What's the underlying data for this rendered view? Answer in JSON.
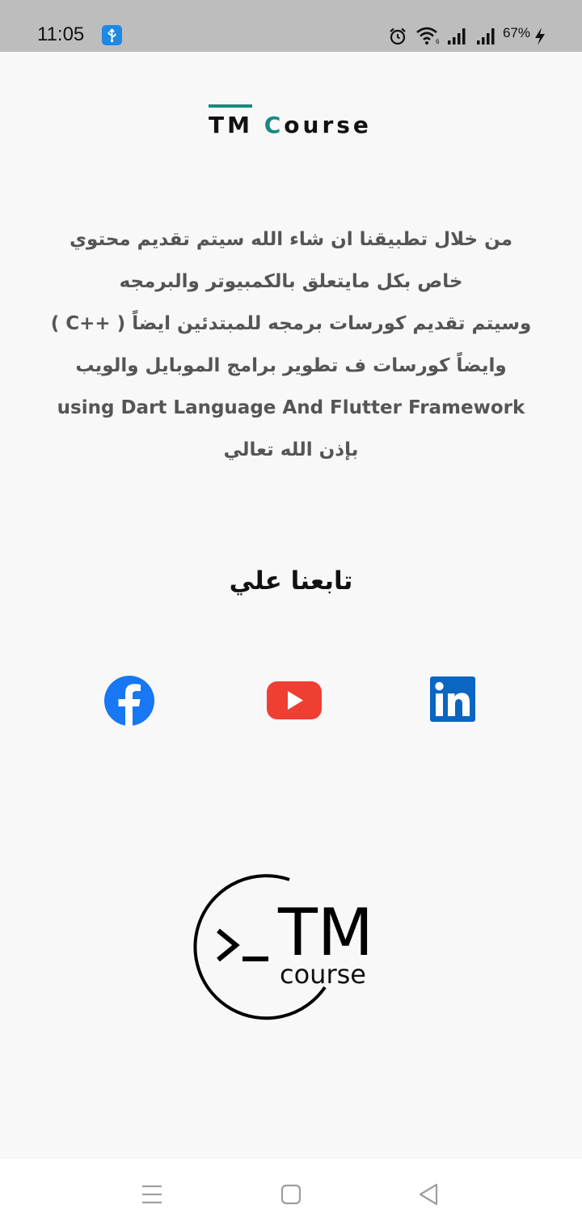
{
  "status_bar": {
    "time": "11:05",
    "battery": "67%",
    "icons": [
      "usb-icon",
      "alarm-icon",
      "wifi-icon",
      "signal-icon",
      "signal-icon",
      "charging-icon"
    ]
  },
  "brand": {
    "prefix": "TM ",
    "c_letter": "C",
    "rest": "ourse",
    "accent": "#1a8a7f"
  },
  "description": {
    "lines": [
      "من خلال تطبيقنا ان شاء الله سيتم تقديم محتوي",
      "خاص بكل مايتعلق بالكمبيوتر والبرمجه",
      "وسيتم تقديم كورسات برمجه للمبتدئين ايضاً ( ++C )",
      "وايضاً كورسات  ف تطوير برامج الموبايل والويب",
      "using Dart Language And Flutter Framework",
      "بإذن الله تعالي"
    ]
  },
  "follow": {
    "title": "تابعنا علي"
  },
  "social": {
    "items": [
      {
        "icon": "facebook-icon",
        "color": "#1877f2"
      },
      {
        "icon": "youtube-icon",
        "color": "#ef3f33"
      },
      {
        "icon": "linkedin-icon",
        "color": "#0a66c2"
      }
    ]
  },
  "logo": {
    "prompt": ">_",
    "title": "TM",
    "subtitle": "course"
  },
  "nav": {
    "icons": [
      "menu-icon",
      "home-icon",
      "back-icon"
    ]
  }
}
